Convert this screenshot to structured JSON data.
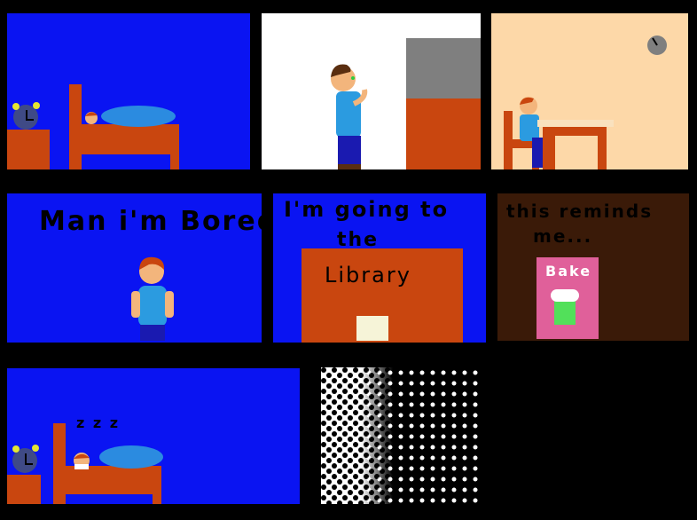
{
  "colors": {
    "frame": "#000000",
    "blue_bg": "#0a14f2",
    "white_bg": "#ffffff",
    "peach_bg": "#fdd8a8",
    "brown_bg": "#3a1a08",
    "furniture": "#c9460f",
    "blanket": "#2b8be0",
    "shirt": "#2b9be0",
    "pants": "#1a1ab0",
    "skin": "#f3b57c",
    "hair": "#9c4a16",
    "tv_gray": "#7f7f7f",
    "book_pink": "#e0609a",
    "book_green": "#52e05a"
  },
  "panels": [
    {
      "id": "bedroom-sleeping",
      "text": ""
    },
    {
      "id": "brushing-teeth",
      "text": ""
    },
    {
      "id": "kitchen-table",
      "text": ""
    },
    {
      "id": "bored",
      "text": "Man i'm Bored"
    },
    {
      "id": "library",
      "line1": "I'm going to",
      "line2": "the",
      "sign": "Library"
    },
    {
      "id": "reminds",
      "line1": "this reminds",
      "line2": "me...",
      "book_title": "Bake"
    },
    {
      "id": "asleep-again",
      "zzz": "z z z"
    },
    {
      "id": "halftone-fade",
      "text": ""
    }
  ]
}
